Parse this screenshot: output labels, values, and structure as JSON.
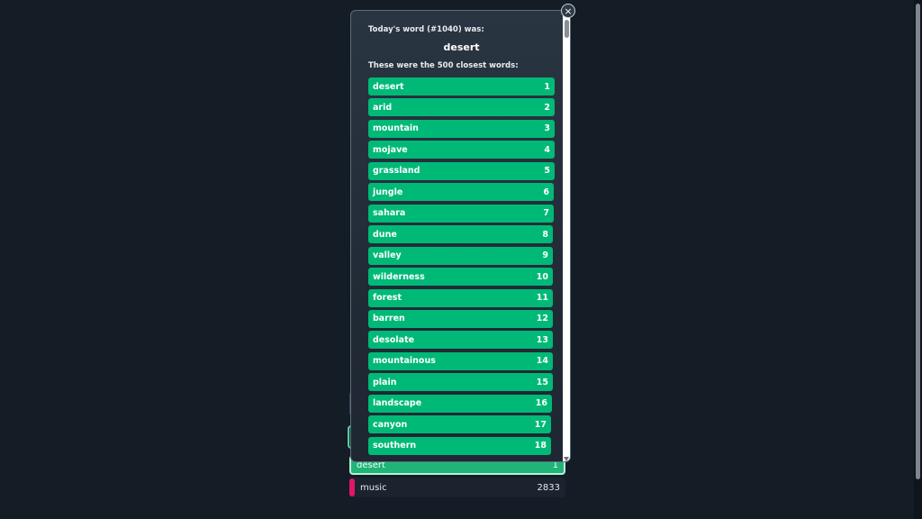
{
  "modal": {
    "title": "Today's word (#1040) was:",
    "word": "desert",
    "subtitle": "These were the 500 closest words:",
    "close_icon": "×",
    "closest_words": [
      {
        "word": "desert",
        "rank": "1"
      },
      {
        "word": "arid",
        "rank": "2"
      },
      {
        "word": "mountain",
        "rank": "3"
      },
      {
        "word": "mojave",
        "rank": "4"
      },
      {
        "word": "grassland",
        "rank": "5"
      },
      {
        "word": "jungle",
        "rank": "6"
      },
      {
        "word": "sahara",
        "rank": "7"
      },
      {
        "word": "dune",
        "rank": "8"
      },
      {
        "word": "valley",
        "rank": "9"
      },
      {
        "word": "wilderness",
        "rank": "10"
      },
      {
        "word": "forest",
        "rank": "11"
      },
      {
        "word": "barren",
        "rank": "12"
      },
      {
        "word": "desolate",
        "rank": "13"
      },
      {
        "word": "mountainous",
        "rank": "14"
      },
      {
        "word": "plain",
        "rank": "15"
      },
      {
        "word": "landscape",
        "rank": "16"
      },
      {
        "word": "canyon",
        "rank": "17"
      },
      {
        "word": "southern",
        "rank": "18"
      }
    ]
  },
  "guesses": [
    {
      "word": "desert",
      "rank": "1"
    },
    {
      "word": "music",
      "rank": "2833"
    }
  ],
  "colors": {
    "background": "#141c26",
    "row_green": "#00b977",
    "far_indicator": "#e2156b"
  }
}
